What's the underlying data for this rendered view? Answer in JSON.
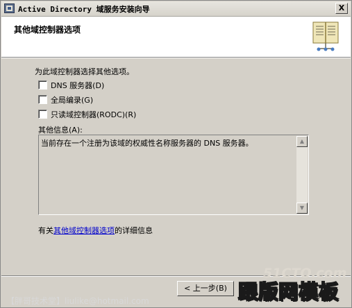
{
  "window": {
    "title": "Active Directory 域服务安装向导",
    "close_label": "X"
  },
  "header": {
    "title": "其他域控制器选项"
  },
  "main": {
    "instruction": "为此域控制器选择其他选项。",
    "options": [
      {
        "label": "DNS 服务器(D)",
        "checked": false
      },
      {
        "label": "全局编录(G)",
        "checked": false
      },
      {
        "label": "只读域控制器(RODC)(R)",
        "checked": false
      }
    ],
    "info_label": "其他信息(A):",
    "info_text": "当前存在一个注册为该域的权威性名称服务器的 DNS 服务器。",
    "link_prefix": "有关",
    "link_text": "其他域控制器选项",
    "link_suffix": "的详细信息"
  },
  "footer": {
    "back_button": "< 上一步(B)",
    "brand": "【胖哥技术堂】liulike@hotmail.com",
    "watermark_51": "51CTO.com",
    "watermark_main": "跟版网模板"
  },
  "icons": {
    "app": "directory-icon",
    "header": "book-icon"
  }
}
